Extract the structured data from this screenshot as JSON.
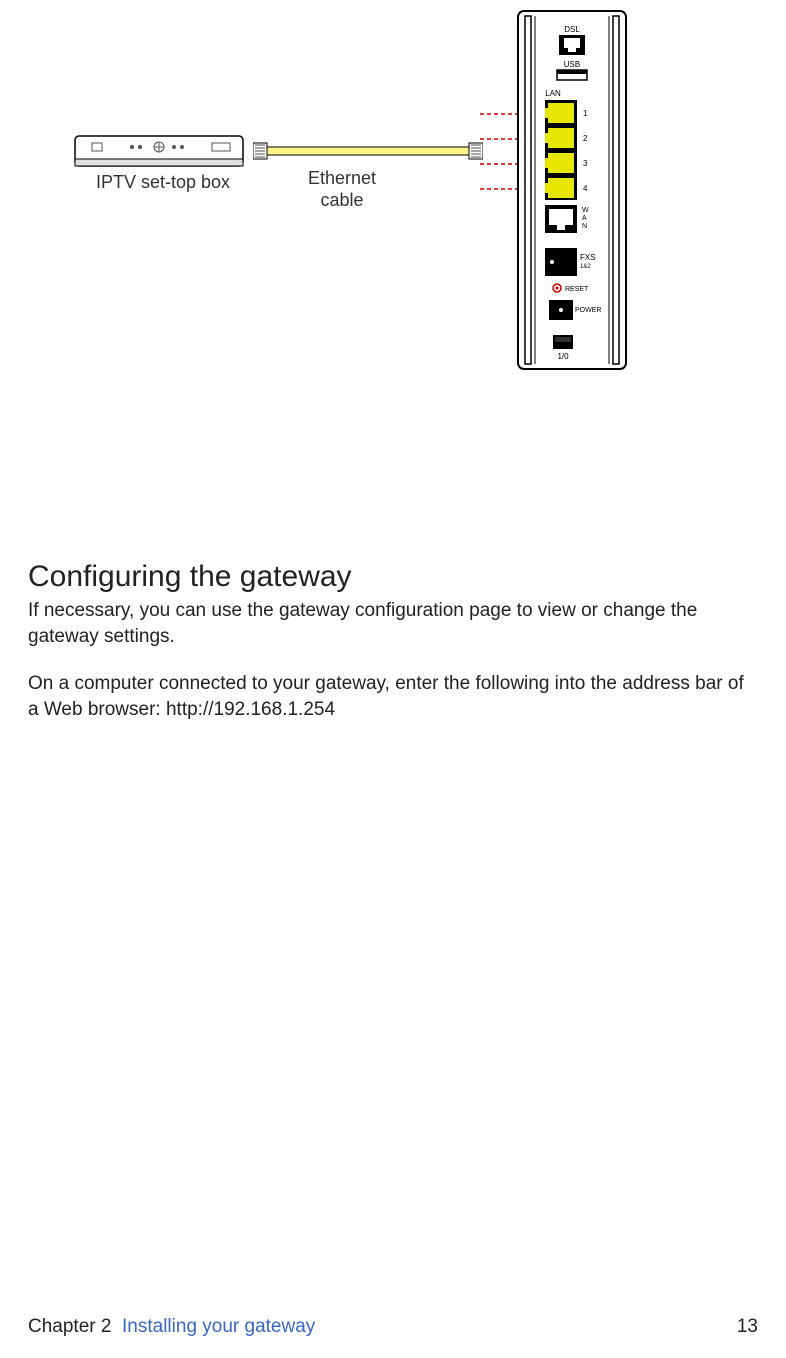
{
  "diagram": {
    "iptv_label": "IPTV set-top box",
    "ethernet_label_line1": "Ethernet",
    "ethernet_label_line2": "cable",
    "ports": {
      "dsl": "DSL",
      "usb": "USB",
      "lan": "LAN",
      "lan1": "1",
      "lan2": "2",
      "lan3": "3",
      "lan4": "4",
      "wan": "W\nA\nN",
      "fxs": "FXS\n1&2",
      "reset": "RESET",
      "power": "POWER",
      "switch": "1/0"
    }
  },
  "heading": "Configuring the gateway",
  "paragraph1": "If necessary, you can use the gateway configuration page to view or change the gateway settings.",
  "paragraph2": "On a computer connected to your gateway, enter the following into the address bar of a Web browser: http://192.168.1.254",
  "footer": {
    "chapter_label": "Chapter 2",
    "chapter_title": "Installing your gateway",
    "page_number": "13"
  }
}
